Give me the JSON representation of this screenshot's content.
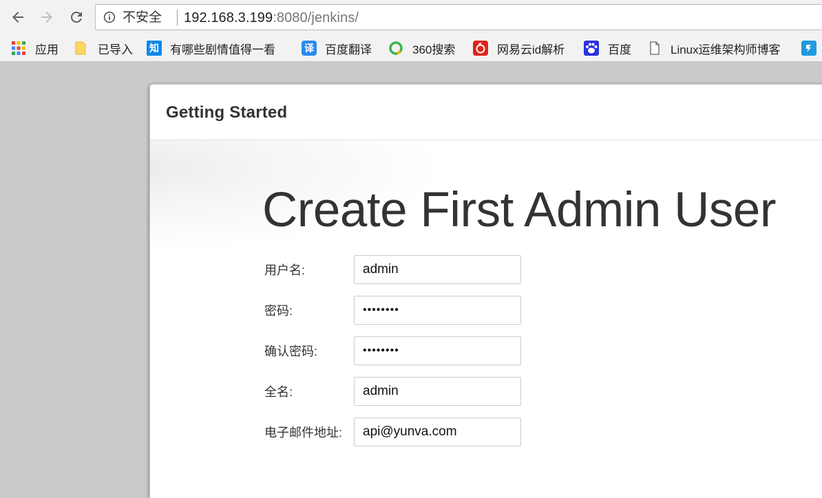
{
  "browser": {
    "security_text": "不安全",
    "url_host": "192.168.3.199",
    "url_rest": ":8080/jenkins/",
    "back_icon": "arrow-left-icon",
    "forward_icon": "arrow-right-icon",
    "reload_icon": "reload-icon",
    "info_icon": "info-icon"
  },
  "bookmarks": [
    {
      "label": "应用",
      "icon": "apps-grid-icon"
    },
    {
      "label": "已导入",
      "icon": "folder-icon"
    },
    {
      "label": "有哪些剧情值得一看",
      "icon": "zhihu-icon",
      "icon_text": "知",
      "color": "#0f88eb"
    },
    {
      "label": "百度翻译",
      "icon": "baidu-translate-icon",
      "icon_text": "译",
      "color": "#2b8af0"
    },
    {
      "label": "360搜索",
      "icon": "360-search-icon"
    },
    {
      "label": "网易云id解析",
      "icon": "netease-music-icon",
      "color": "#e2231a"
    },
    {
      "label": "百度",
      "icon": "baidu-paw-icon",
      "color": "#2932e1"
    },
    {
      "label": "Linux运维架构师博客",
      "icon": "page-icon"
    },
    {
      "label": "",
      "icon": "app-icon",
      "color": "#1e9be0"
    }
  ],
  "panel": {
    "title": "Getting Started",
    "heading": "Create First Admin User"
  },
  "form": {
    "fields": [
      {
        "label": "用户名:",
        "value": "admin"
      },
      {
        "label": "密码:",
        "value": "••••••••"
      },
      {
        "label": "确认密码:",
        "value": "••••••••"
      },
      {
        "label": "全名:",
        "value": "admin"
      },
      {
        "label": "电子邮件地址:",
        "value": "api@yunva.com"
      }
    ]
  }
}
